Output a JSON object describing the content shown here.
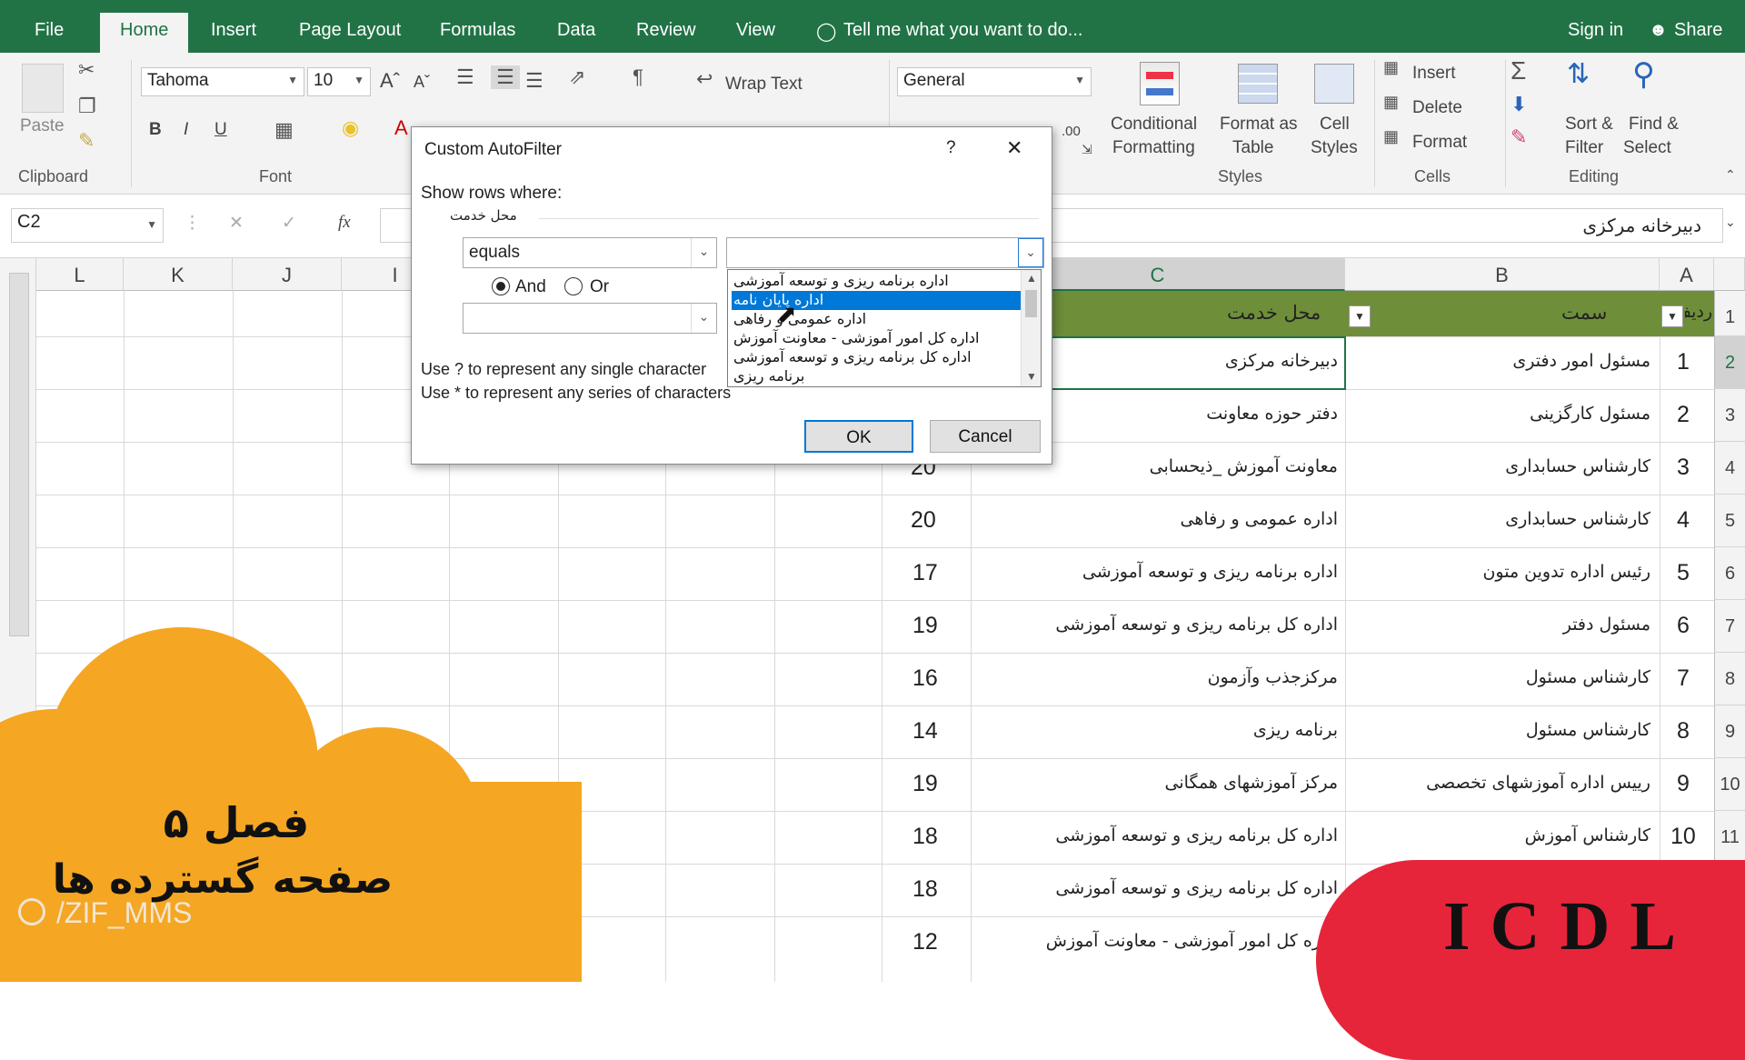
{
  "tabs": {
    "file": "File",
    "home": "Home",
    "insert": "Insert",
    "page_layout": "Page Layout",
    "formulas": "Formulas",
    "data": "Data",
    "review": "Review",
    "view": "View",
    "tell_me": "Tell me what you want to do...",
    "sign_in": "Sign in",
    "share": "Share"
  },
  "ribbon": {
    "paste": "Paste",
    "clipboard": "Clipboard",
    "font_name": "Tahoma",
    "font_size": "10",
    "font_group": "Font",
    "bold": "B",
    "italic": "I",
    "underline": "U",
    "wrap_text": "Wrap Text",
    "number_format": "General",
    "conditional_1": "Conditional",
    "conditional_2": "Formatting",
    "format_as_1": "Format as",
    "format_as_2": "Table",
    "cell_styles_1": "Cell",
    "cell_styles_2": "Styles",
    "styles_group": "Styles",
    "insert": "Insert",
    "delete": "Delete",
    "format": "Format",
    "cells_group": "Cells",
    "sort_1": "Sort &",
    "sort_2": "Filter",
    "find_1": "Find &",
    "find_2": "Select",
    "editing_group": "Editing"
  },
  "formula_bar": {
    "name_box": "C2",
    "fx": "fx",
    "value": "دبیرخانه مرکزی"
  },
  "columns": {
    "L": "L",
    "K": "K",
    "J": "J",
    "I": "I",
    "C": "C",
    "B": "B",
    "A": "A"
  },
  "header_row": {
    "c": "محل خدمت",
    "b": "سمت",
    "a": "ردیف"
  },
  "rows": [
    {
      "row": "1",
      "a": "",
      "b": "",
      "c": "",
      "d": ""
    },
    {
      "row": "2",
      "a": "1",
      "b": "مسئول امور دفتری",
      "c": "دبیرخانه مرکزی",
      "d": ""
    },
    {
      "row": "3",
      "a": "2",
      "b": "مسئول کارگزینی",
      "c": "دفتر حوزه معاونت",
      "d": ""
    },
    {
      "row": "4",
      "a": "3",
      "b": "کارشناس حسابداری",
      "c": "معاونت آموزش _ذیحسابی",
      "d": "20"
    },
    {
      "row": "5",
      "a": "4",
      "b": "کارشناس حسابداری",
      "c": "اداره عمومی و رفاهی",
      "d": "20"
    },
    {
      "row": "6",
      "a": "5",
      "b": "رئیس اداره تدوین متون",
      "c": "اداره برنامه ریزی و توسعه آموزشی",
      "d": "17"
    },
    {
      "row": "7",
      "a": "6",
      "b": "مسئول دفتر",
      "c": "اداره کل برنامه ریزی و توسعه آموزشی",
      "d": "19"
    },
    {
      "row": "8",
      "a": "7",
      "b": "کارشناس مسئول",
      "c": "مرکزجذب وآزمون",
      "d": "16"
    },
    {
      "row": "9",
      "a": "8",
      "b": "کارشناس مسئول",
      "c": "برنامه ریزی",
      "d": "14"
    },
    {
      "row": "10",
      "a": "9",
      "b": "رییس اداره آموزشهای تخصصی",
      "c": "مرکز آموزشهای همگانی",
      "d": "19"
    },
    {
      "row": "11",
      "a": "10",
      "b": "کارشناس آموزش",
      "c": "اداره کل برنامه ریزی و توسعه آموزشی",
      "d": "18"
    },
    {
      "row": "",
      "a": "",
      "b": "",
      "c": "اداره کل برنامه ریزی و توسعه آموزشی",
      "d": "18"
    },
    {
      "row": "",
      "a": "",
      "b": "",
      "c": "اداره کل امور آموزشی - معاونت آموزش",
      "d": "12"
    }
  ],
  "dialog": {
    "title": "Custom AutoFilter",
    "help": "?",
    "close": "✕",
    "show_rows": "Show rows where:",
    "field_name": "محل خدمت",
    "operator1": "equals",
    "value1": "",
    "and": "And",
    "or": "Or",
    "operator2": "",
    "hint1": "Use ? to represent any single character",
    "hint2": "Use * to represent any series of characters",
    "ok": "OK",
    "cancel": "Cancel",
    "list": [
      "اداره برنامه ریزی و توسعه آموزشی",
      "اداره پایان نامه",
      "اداره عمومی و رفاهی",
      "اداره کل امور آموزشی - معاونت آموزش",
      "اداره کل برنامه ریزی و توسعه آموزشی",
      "برنامه ریزی"
    ],
    "selected_index": 1
  },
  "overlay": {
    "chapter": "فصل ۵",
    "subtitle": "صفحه گسترده ها",
    "handle": "/ZIF_MMS",
    "badge": "ICDL"
  },
  "colors": {
    "excel_green": "#217346",
    "header_fill": "#6e8e3a",
    "cloud": "#f5a623",
    "badge": "#e7253a",
    "selection": "#0078d7"
  }
}
